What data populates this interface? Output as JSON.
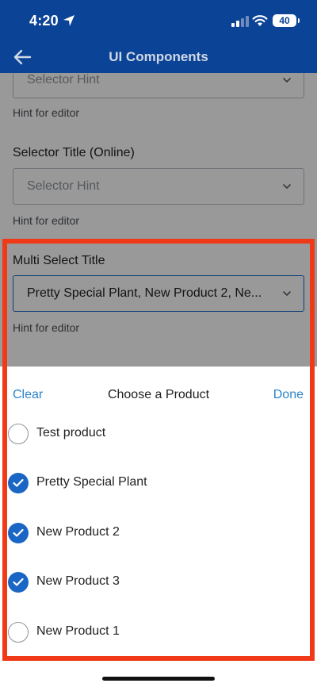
{
  "status": {
    "time": "4:20",
    "battery": "40",
    "location_icon": "location-arrow-icon",
    "signal_icon": "cellular-signal-icon",
    "wifi_icon": "wifi-icon"
  },
  "nav": {
    "title": "UI Components",
    "back_icon": "back-arrow-icon"
  },
  "form": {
    "selector_1": {
      "placeholder": "Selector Hint",
      "hint": "Hint for editor"
    },
    "selector_online": {
      "title": "Selector Title (Online)",
      "placeholder": "Selector Hint",
      "hint": "Hint for editor"
    },
    "multi_select": {
      "title": "Multi Select Title",
      "value": "Pretty Special Plant, New Product 2, Ne...",
      "hint": "Hint for editor"
    }
  },
  "sheet": {
    "clear_label": "Clear",
    "title": "Choose a Product",
    "done_label": "Done",
    "options": [
      {
        "label": "Test product",
        "selected": false
      },
      {
        "label": "Pretty Special Plant",
        "selected": true
      },
      {
        "label": "New Product 2",
        "selected": true
      },
      {
        "label": "New Product 3",
        "selected": true
      },
      {
        "label": "New Product 1",
        "selected": false
      }
    ]
  },
  "colors": {
    "brand": "#0b4396",
    "accent": "#1a66c4",
    "link": "#2a83c9",
    "highlight": "#f03a17"
  }
}
